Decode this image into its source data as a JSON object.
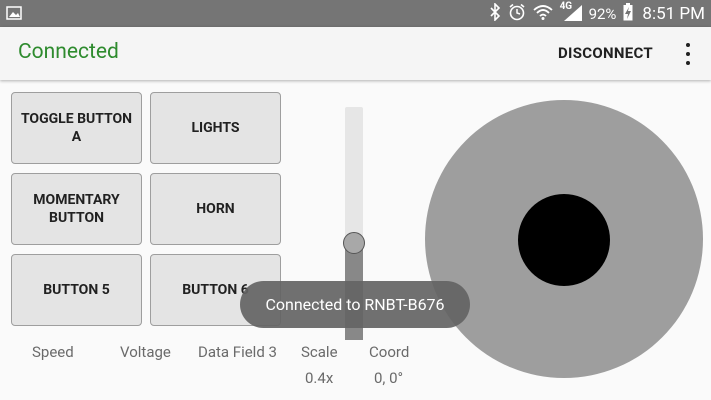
{
  "status_bar": {
    "battery": "92%",
    "time": "8:51 PM",
    "network": "4G"
  },
  "app_bar": {
    "title": "Connected",
    "title_color": "#2e8b2e",
    "disconnect_label": "DISCONNECT"
  },
  "buttons": [
    {
      "label": "TOGGLE BUTTON A"
    },
    {
      "label": "LIGHTS"
    },
    {
      "label": "MOMENTARY BUTTON"
    },
    {
      "label": "HORN"
    },
    {
      "label": "BUTTON 5"
    },
    {
      "label": "BUTTON 6"
    }
  ],
  "slider": {
    "level": 0.41
  },
  "fields": {
    "speed": "Speed",
    "voltage": "Voltage",
    "data_field_3": "Data Field 3",
    "scale_label": "Scale",
    "scale_value": "0.4x",
    "coord_label": "Coord",
    "coord_value": "0, 0°"
  },
  "toast": {
    "message": "Connected to RNBT-B676"
  }
}
